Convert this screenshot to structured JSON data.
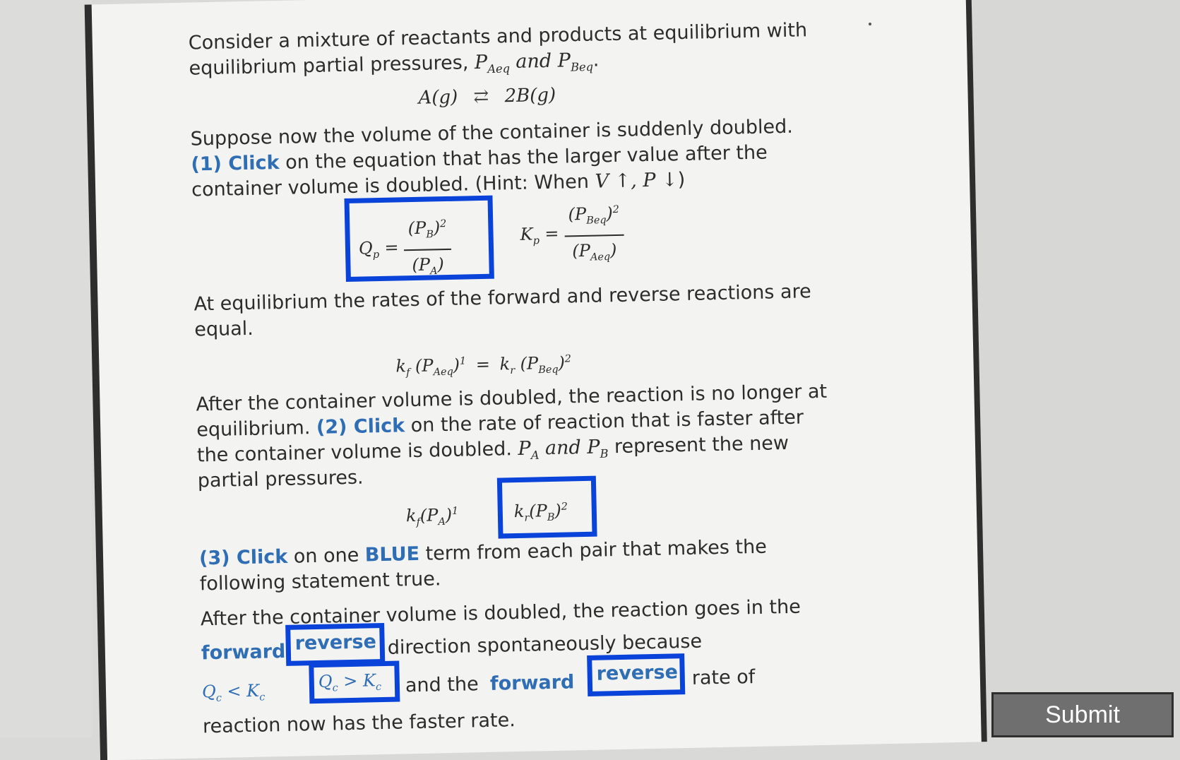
{
  "intro": {
    "line1": "Consider a mixture of reactants and products at equilibrium with",
    "line2_text": "equilibrium partial pressures,",
    "p_a_eq": "P",
    "p_a_eq_sub": "Aeq",
    "and": "and",
    "p_b_eq": "P",
    "p_b_eq_sub": "Beq",
    "period": "."
  },
  "reaction": {
    "left": "A(g)",
    "arrow": "⇄",
    "right": "2B(g)"
  },
  "step1": {
    "line1": "Suppose now the volume of the container is suddenly doubled.",
    "label": "(1) Click",
    "line2_rest": "on the equation that has the larger value after the",
    "line3": "container volume is doubled. (Hint: When",
    "hint_math": "V ↑, P ↓",
    "close": ")"
  },
  "qp_eq": {
    "lhs": "Q",
    "lhs_sub": "p",
    "num": "(P",
    "num_sub": "B",
    "num_end": ")",
    "num_sup": "2",
    "den": "(P",
    "den_sub": "A",
    "den_end": ")"
  },
  "kp_eq": {
    "lhs": "K",
    "lhs_sub": "p",
    "num": "(P",
    "num_sub": "Beq",
    "num_end": ")",
    "num_sup": "2",
    "den": "(P",
    "den_sub": "Aeq",
    "den_end": ")"
  },
  "equilibrium": {
    "line1": "At equilibrium the rates of the forward and reverse reactions are",
    "line2": "equal."
  },
  "rate_eq": {
    "kf": "k",
    "kf_sub": "f",
    "pa": "(P",
    "pa_sub": "Aeq",
    "pa_end": ")",
    "pa_sup": "1",
    "eq": "=",
    "kr": "k",
    "kr_sub": "r",
    "pb": "(P",
    "pb_sub": "Beq",
    "pb_end": ")",
    "pb_sup": "2"
  },
  "step2": {
    "line1": "After the container volume is doubled, the reaction is no longer at",
    "line2_a": "equilibrium.",
    "label": "(2) Click",
    "line2_b": "on the rate of reaction that is faster after",
    "line3_a": "the container volume is doubled.",
    "pa": "P",
    "pa_sub": "A",
    "line3_and": "and",
    "pb": "P",
    "pb_sub": "B",
    "line3_b": "represent the new",
    "line4": "partial pressures."
  },
  "rate_forward": {
    "k": "k",
    "k_sub": "f",
    "p": "(P",
    "p_sub": "A",
    "p_end": ")",
    "p_sup": "1"
  },
  "rate_reverse": {
    "k": "k",
    "k_sub": "r",
    "p": "(P",
    "p_sub": "B",
    "p_end": ")",
    "p_sup": "2"
  },
  "step3": {
    "label": "(3) Click",
    "line1_a": "on one",
    "blue_word": "BLUE",
    "line1_b": "term from each pair that makes the",
    "line2": "following statement true."
  },
  "statement": {
    "line1": "After the container volume is doubled, the reaction goes in the",
    "opt_forward": "forward",
    "opt_reverse": "reverse",
    "direction_text": "direction spontaneously because",
    "opt_q_less": "Q",
    "opt_q_less_sub": "c",
    "opt_q_less_rel": "<",
    "opt_q_less_k": "K",
    "opt_q_less_k_sub": "c",
    "opt_q_greater": "Q",
    "opt_q_greater_sub": "c",
    "opt_q_greater_rel": ">",
    "opt_q_greater_k": "K",
    "opt_q_greater_k_sub": "c",
    "and_the": "and the",
    "opt_rate_forward": "forward",
    "opt_rate_reverse": "reverse",
    "rate_of": "rate of",
    "last_line": "reaction now has the faster rate."
  },
  "submit": {
    "label": "Submit"
  },
  "colors": {
    "accent_box": "#0a43d9",
    "blue_text": "#2f6db4",
    "submit_bg": "#6f6f6f"
  }
}
